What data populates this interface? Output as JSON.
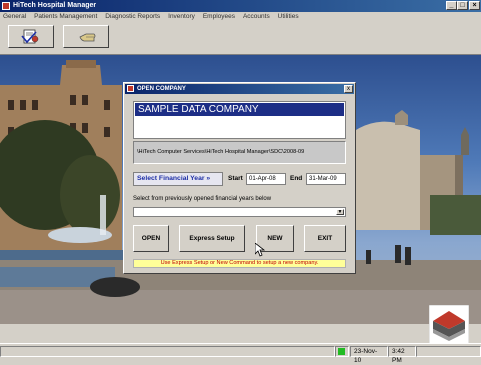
{
  "window": {
    "title": "HiTech Hospital Manager",
    "buttons": {
      "minimize": "_",
      "maximize": "□",
      "close": "×"
    }
  },
  "menu": [
    "General",
    "Patients Management",
    "Diagnostic Reports",
    "Inventory",
    "Employees",
    "Accounts",
    "Utilities"
  ],
  "toolbar": {
    "icons": [
      "patient-record-icon",
      "hand-pointer-icon"
    ]
  },
  "dialog": {
    "title": "OPEN COMPANY",
    "close_label": "x",
    "company_name": "SAMPLE DATA COMPANY",
    "path": "\\HiTech Computer Services\\HiTech Hospital Manager\\SDC\\2008-09",
    "financial_year_label": "Select Financial Year »",
    "start_label": "Start",
    "start_value": "01-Apr-08",
    "end_label": "End",
    "end_value": "31-Mar-09",
    "select_label": "Select from previously opened financial years below",
    "select_value": "",
    "buttons": {
      "open": "OPEN",
      "express": "Express Setup",
      "new": "NEW",
      "exit": "EXIT"
    },
    "hint": "Use Express Setup or New Command to setup a new company."
  },
  "statusbar": {
    "date": "23-Nov-10",
    "time": "3:42 PM"
  },
  "colors": {
    "titlebar": "#0a246a",
    "company_banner": "#1d2e86",
    "hint_bg": "#ffff99",
    "hint_text": "#c00000",
    "status_indicator": "#22bb22"
  }
}
